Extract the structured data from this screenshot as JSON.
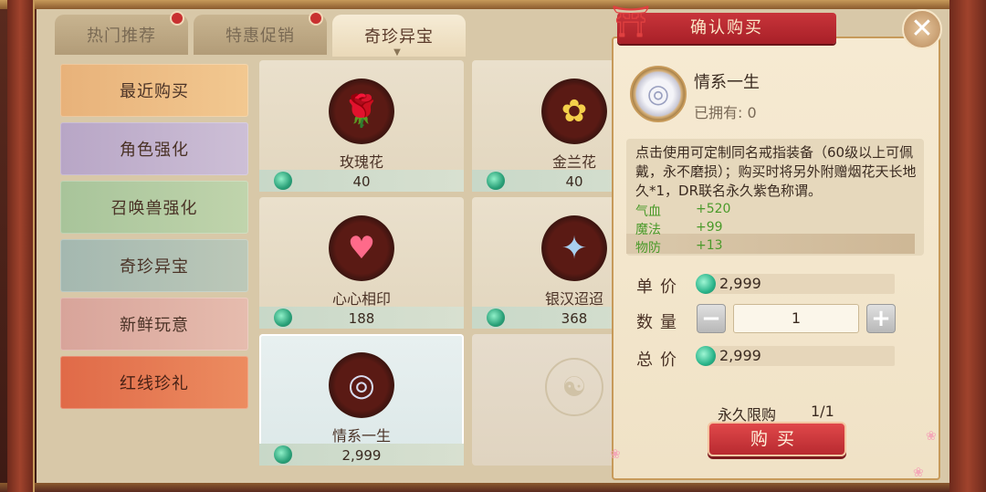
{
  "tabs": [
    {
      "label": "热门推荐",
      "active": false,
      "badge": true
    },
    {
      "label": "特惠促销",
      "active": false,
      "badge": true
    },
    {
      "label": "奇珍异宝",
      "active": true,
      "badge": false
    }
  ],
  "categories": [
    {
      "label": "最近购买"
    },
    {
      "label": "角色强化"
    },
    {
      "label": "召唤兽强化"
    },
    {
      "label": "奇珍异宝"
    },
    {
      "label": "新鲜玩意"
    },
    {
      "label": "红线珍礼"
    }
  ],
  "items": [
    {
      "name": "玫瑰花",
      "price": "40",
      "icon": "rose-icon"
    },
    {
      "name": "金兰花",
      "price": "40",
      "icon": "lily-icon"
    },
    {
      "name": "心心相印",
      "price": "188",
      "icon": "heart-box-icon"
    },
    {
      "name": "银汉迢迢",
      "price": "368",
      "icon": "magpie-bridge-icon"
    },
    {
      "name": "情系一生",
      "price": "2,999",
      "icon": "ring-icon",
      "selected": true
    }
  ],
  "dialog": {
    "title": "确认购买",
    "product_name": "情系一生",
    "owned": "已拥有: 0",
    "description": "点击使用可定制同名戒指装备（60级以上可佩戴，永不磨损）；购买时将另外附赠烟花天长地久*1，DR联名永久紫色称谓。",
    "stats": [
      {
        "name": "气血",
        "value": "+520"
      },
      {
        "name": "魔法",
        "value": "+99"
      },
      {
        "name": "物防",
        "value": "+13"
      }
    ],
    "unit_price_label": "单价",
    "unit_price": "2,999",
    "quantity_label": "数量",
    "quantity": "1",
    "total_label": "总价",
    "total": "2,999",
    "limit_label": "永久限购",
    "limit_value": "1/1",
    "buy_label": "购买"
  },
  "colors": {
    "accent_red": "#c8343a",
    "jade_currency": "#2aa078",
    "stat_green": "#4a9a2a"
  }
}
